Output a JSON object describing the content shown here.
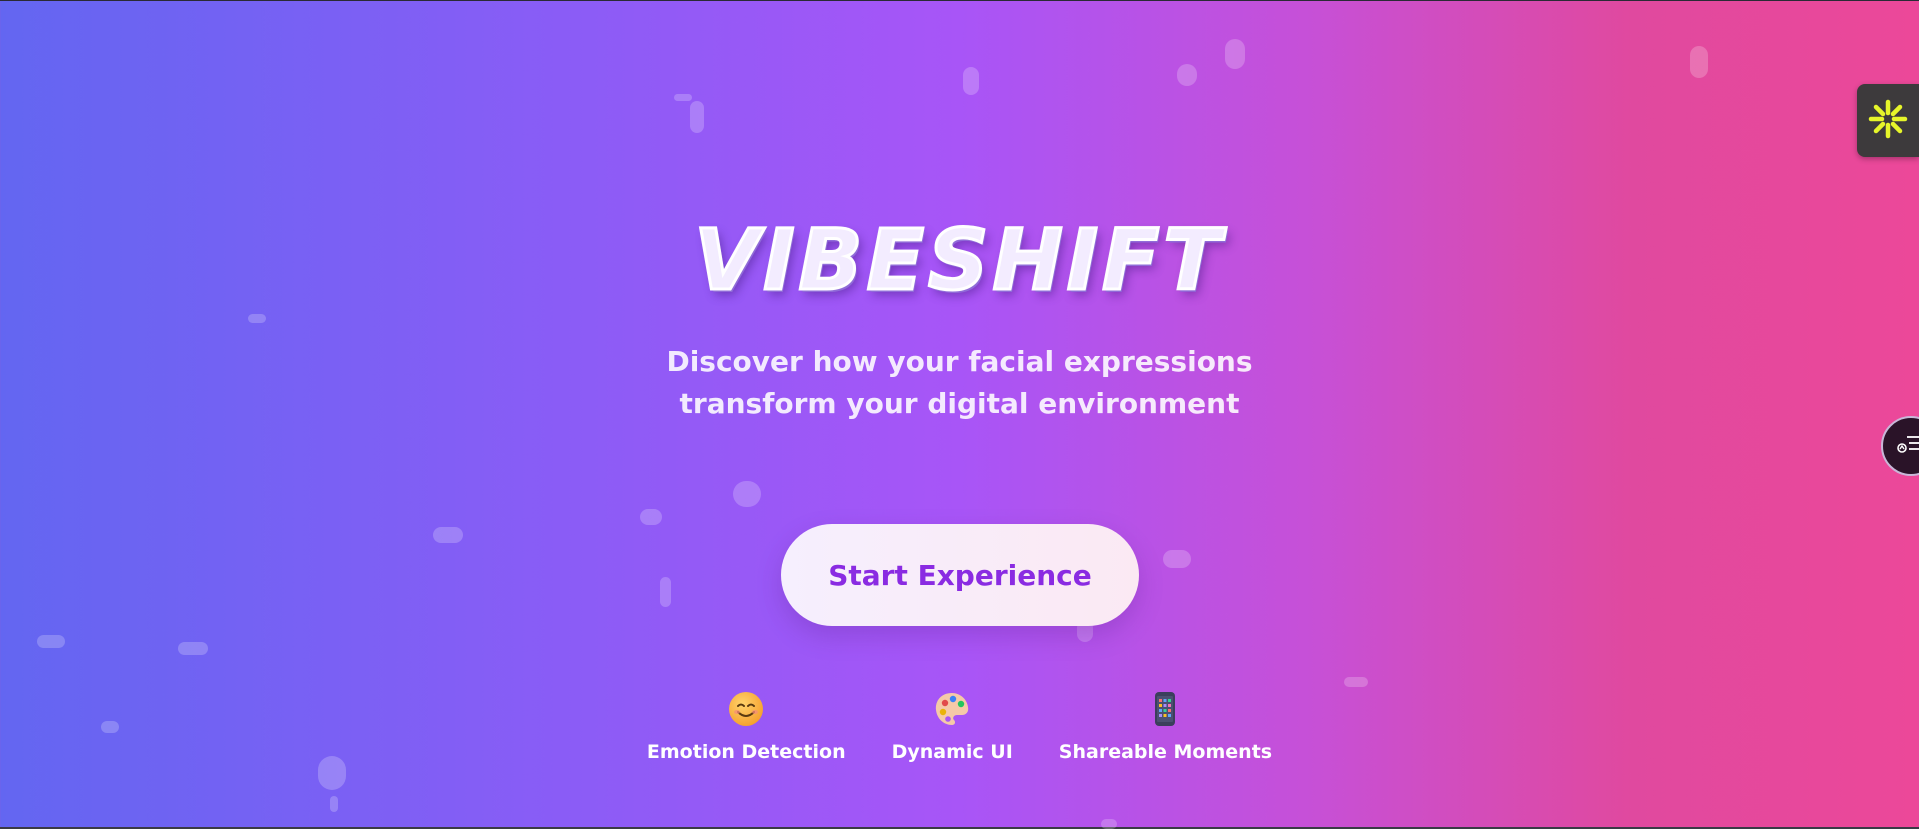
{
  "hero": {
    "title": "VIBESHIFT",
    "subtitle_line1": "Discover how your facial expressions",
    "subtitle_line2": "transform your digital environment",
    "cta_label": "Start Experience"
  },
  "features": [
    {
      "icon": "smiling-face-icon",
      "label": "Emotion Detection"
    },
    {
      "icon": "palette-icon",
      "label": "Dynamic UI"
    },
    {
      "icon": "phone-grid-icon",
      "label": "Shareable Moments"
    }
  ],
  "side_widgets": {
    "top_icon": "sparkle-icon",
    "round_icon": "menu-list-icon"
  },
  "colors": {
    "gradient_start": "#6366f1",
    "gradient_mid": "#a855f7",
    "gradient_end": "#ec4899",
    "cta_text": "#8a2be2",
    "sparkle": "#e6f52a"
  }
}
